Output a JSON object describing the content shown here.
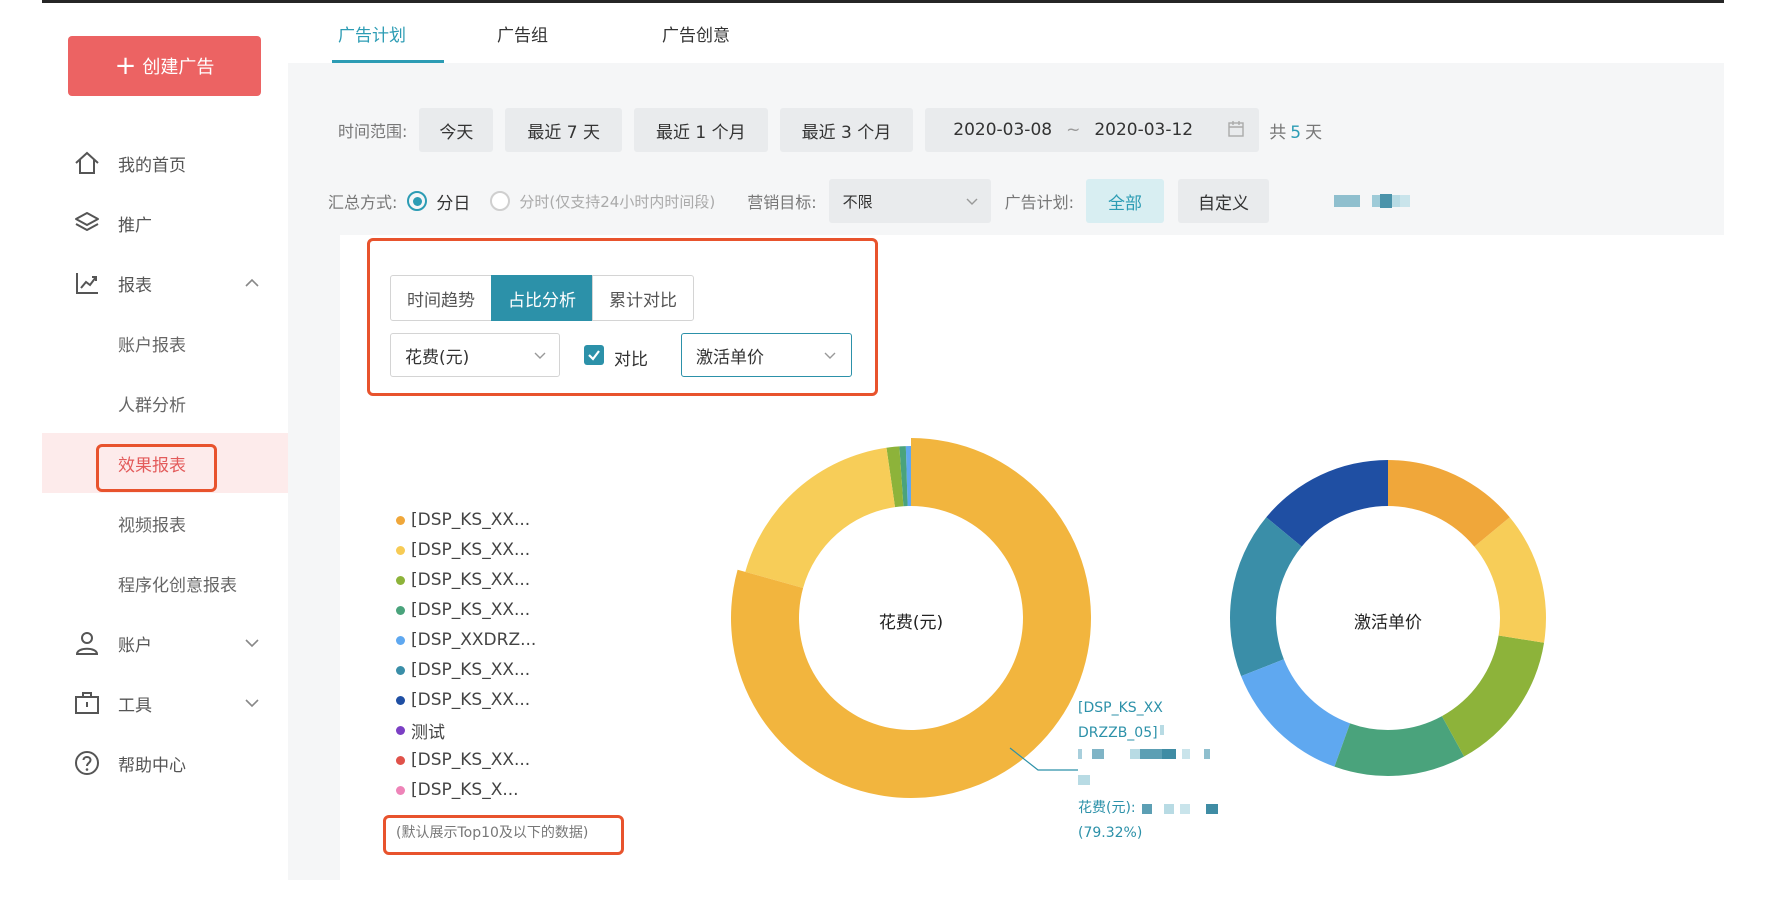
{
  "sidebar": {
    "create_label": "创建广告",
    "items": [
      {
        "label": "我的首页"
      },
      {
        "label": "推广"
      },
      {
        "label": "报表"
      },
      {
        "label": "账户"
      },
      {
        "label": "工具"
      },
      {
        "label": "帮助中心"
      }
    ],
    "report_subitems": [
      {
        "label": "账户报表"
      },
      {
        "label": "人群分析"
      },
      {
        "label": "效果报表"
      },
      {
        "label": "视频报表"
      },
      {
        "label": "程序化创意报表"
      }
    ]
  },
  "tabs": [
    {
      "label": "广告计划"
    },
    {
      "label": "广告组"
    },
    {
      "label": "广告创意"
    }
  ],
  "filters": {
    "time_label": "时间范围:",
    "quick": [
      "今天",
      "最近 7 天",
      "最近 1 个月",
      "最近 3 个月"
    ],
    "date_start": "2020-03-08",
    "date_sep": "~",
    "date_end": "2020-03-12",
    "days_prefix": "共",
    "days_count": "5",
    "days_suffix": "天",
    "agg_label": "汇总方式:",
    "agg_day": "分日",
    "agg_hour": "分时(仅支持24小时内时间段)",
    "goal_label": "营销目标:",
    "goal_value": "不限",
    "plan_label": "广告计划:",
    "plan_all": "全部",
    "plan_custom": "自定义"
  },
  "chart_controls": {
    "modes": [
      "时间趋势",
      "占比分析",
      "累计对比"
    ],
    "metric1": "花费(元)",
    "compare_label": "对比",
    "metric2": "激活单价"
  },
  "legend_items": [
    {
      "label": "[DSP_KS_XX...",
      "color": "#f0a73a"
    },
    {
      "label": "[DSP_KS_XX...",
      "color": "#f7cb55"
    },
    {
      "label": "[DSP_KS_XX...",
      "color": "#8db33a"
    },
    {
      "label": "[DSP_KS_XX...",
      "color": "#4aa37c"
    },
    {
      "label": "[DSP_XXDRZ...",
      "color": "#5fa8f0"
    },
    {
      "label": "[DSP_KS_XX...",
      "color": "#3a8ea8"
    },
    {
      "label": "[DSP_KS_XX...",
      "color": "#1f4fa3"
    },
    {
      "label": "测试",
      "color": "#7b3fc4"
    },
    {
      "label": "[DSP_KS_XX...",
      "color": "#e0524a"
    },
    {
      "label": " [DSP_KS_X...",
      "color": "#ee84b8"
    }
  ],
  "legend_note": "(默认展示Top10及以下的数据)",
  "chart_data": [
    {
      "type": "pie",
      "title": "花费(元)",
      "categories": [
        "[DSP_KS_XX...",
        "[DSP_KS_XX...",
        "[DSP_KS_XX...",
        "[DSP_KS_XX...",
        "[DSP_XXDRZ..."
      ],
      "values": [
        79.32,
        18.4,
        1.2,
        0.6,
        0.48
      ],
      "colors": [
        "#f2b53e",
        "#f7cd58",
        "#8db33a",
        "#4aa37c",
        "#5fa8f0"
      ],
      "donut": true,
      "tooltip": {
        "line1": "[DSP_KS_XX",
        "line2": "DRZZB_05]",
        "label": "花费(元):",
        "percent": "(79.32%)"
      }
    },
    {
      "type": "pie",
      "title": "激活单价",
      "categories": [
        "[DSP_KS_XX...",
        "[DSP_KS_XX...",
        "[DSP_KS_XX...",
        "[DSP_KS_XX...",
        "[DSP_XXDRZ...",
        "[DSP_KS_XX...",
        "[DSP_KS_XX..."
      ],
      "values": [
        14.0,
        13.5,
        14.5,
        13.5,
        13.5,
        17.0,
        14.0
      ],
      "colors": [
        "#f0a73a",
        "#f7cd58",
        "#8db33a",
        "#4aa37c",
        "#5fa8f0",
        "#3a8ea8",
        "#1f4fa3"
      ],
      "donut": true
    }
  ]
}
